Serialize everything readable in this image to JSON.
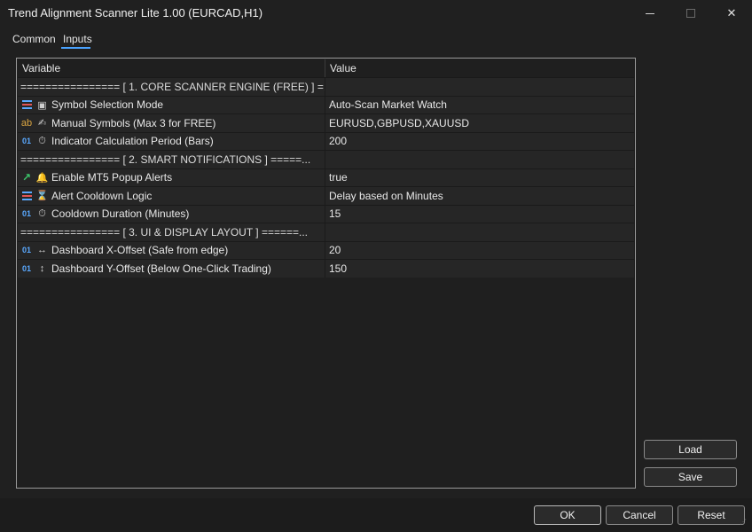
{
  "window": {
    "title": "Trend Alignment Scanner Lite 1.00 (EURCAD,H1)",
    "min_icon": "minimize-icon",
    "max_icon": "maximize-icon",
    "close_icon": "close-icon",
    "close_glyph": "✕"
  },
  "tabs": [
    {
      "label": "Common"
    },
    {
      "label": "Inputs",
      "active": true
    }
  ],
  "table": {
    "col_variable": "Variable",
    "col_value": "Value",
    "rows": [
      {
        "type": "section",
        "variable": "================ [ 1. CORE SCANNER ENGINE (FREE) ] =...",
        "value": ""
      },
      {
        "type": "enum",
        "type_icon": "enum-list-icon",
        "glyph_icon": "chart-icon",
        "glyph": "▣",
        "variable": "Symbol Selection Mode",
        "value": "Auto-Scan Market Watch"
      },
      {
        "type": "string",
        "type_icon": "string-ab-icon",
        "type_glyph": "ab",
        "glyph_icon": "pen-icon",
        "glyph": "✍",
        "variable": "Manual Symbols (Max 3 for FREE)",
        "value": "EURUSD,GBPUSD,XAUUSD"
      },
      {
        "type": "int",
        "type_icon": "integer-01-icon",
        "type_glyph": "01",
        "glyph_icon": "timer-icon",
        "glyph": "⏱",
        "variable": "Indicator Calculation Period (Bars)",
        "value": "200"
      },
      {
        "type": "section",
        "variable": "================ [ 2. SMART NOTIFICATIONS ] =====...",
        "value": ""
      },
      {
        "type": "bool",
        "type_icon": "bool-arrow-icon",
        "type_glyph": "↗",
        "glyph_icon": "bell-icon",
        "glyph": "🔔",
        "variable": "Enable MT5 Popup Alerts",
        "value": "true"
      },
      {
        "type": "enum",
        "type_icon": "enum-list-icon",
        "glyph_icon": "hourglass-icon",
        "glyph": "⌛",
        "variable": "Alert Cooldown Logic",
        "value": "Delay based on Minutes"
      },
      {
        "type": "int",
        "type_icon": "integer-01-icon",
        "type_glyph": "01",
        "glyph_icon": "timer-icon",
        "glyph": "⏱",
        "variable": "Cooldown Duration (Minutes)",
        "value": "15"
      },
      {
        "type": "section",
        "variable": "================ [ 3. UI & DISPLAY LAYOUT ] ======...",
        "value": ""
      },
      {
        "type": "int",
        "type_icon": "integer-01-icon",
        "type_glyph": "01",
        "glyph_icon": "horizontal-arrows-icon",
        "glyph": "↔",
        "variable": "Dashboard X-Offset (Safe from edge)",
        "value": "20"
      },
      {
        "type": "int",
        "type_icon": "integer-01-icon",
        "type_glyph": "01",
        "glyph_icon": "vertical-arrows-icon",
        "glyph": "↕",
        "variable": "Dashboard Y-Offset (Below One-Click Trading)",
        "value": "150"
      }
    ]
  },
  "buttons": {
    "load": "Load",
    "save": "Save",
    "ok": "OK",
    "cancel": "Cancel",
    "reset": "Reset"
  },
  "colors": {
    "accent": "#4aa3ff",
    "int_icon": "#5aa9ff",
    "string_icon": "#d9a441",
    "bool_icon": "#3cc76b",
    "enum_red": "#e05555"
  }
}
